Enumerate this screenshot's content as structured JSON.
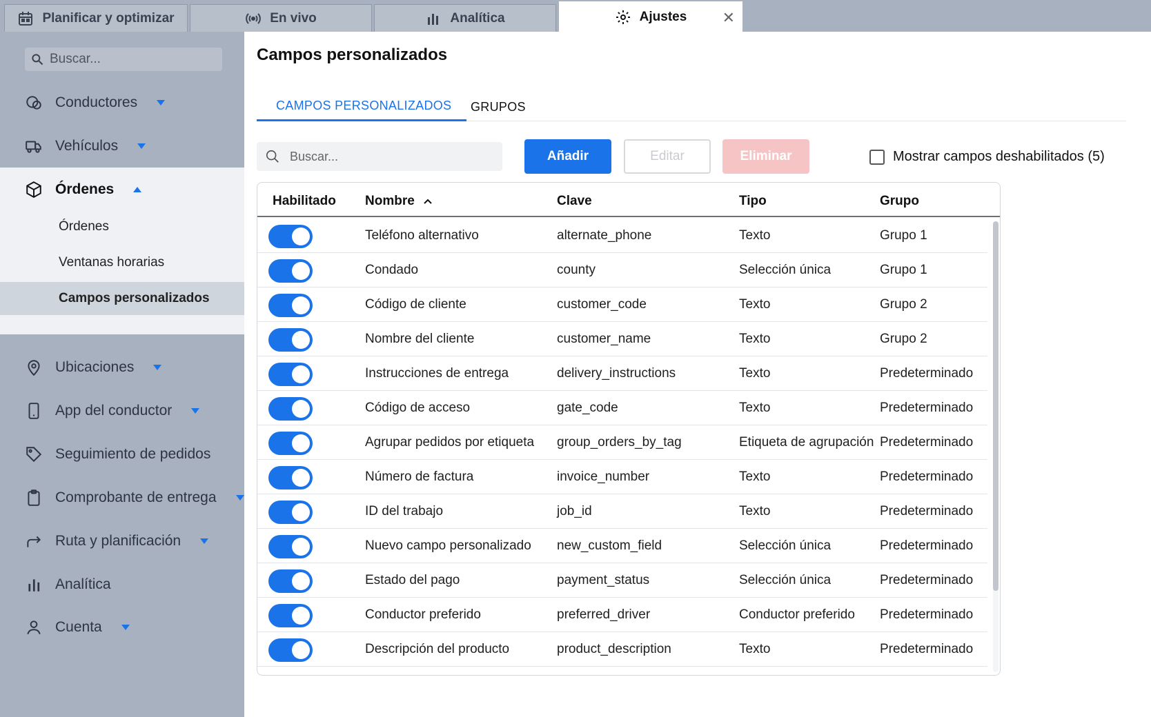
{
  "tabs": [
    {
      "label": "Planificar y optimizar",
      "icon": "calendar-icon"
    },
    {
      "label": "En vivo",
      "icon": "broadcast-icon"
    },
    {
      "label": "Analítica",
      "icon": "bar-chart-icon"
    },
    {
      "label": "Ajustes",
      "icon": "gear-icon",
      "active": true
    }
  ],
  "sidebar": {
    "search_placeholder": "Buscar...",
    "items": [
      {
        "label": "Conductores",
        "icon": "steering-icon"
      },
      {
        "label": "Vehículos",
        "icon": "truck-icon"
      },
      {
        "label": "Órdenes",
        "icon": "box-icon",
        "expanded": true
      },
      {
        "label": "Ubicaciones",
        "icon": "location-pin-icon"
      },
      {
        "label": "App del conductor",
        "icon": "phone-icon"
      },
      {
        "label": "Seguimiento de pedidos",
        "icon": "tag-icon"
      },
      {
        "label": "Comprobante de entrega",
        "icon": "clipboard-icon"
      },
      {
        "label": "Ruta y planificación",
        "icon": "route-arrow-icon"
      },
      {
        "label": "Analítica",
        "icon": "bar-chart-icon"
      },
      {
        "label": "Cuenta",
        "icon": "user-icon"
      }
    ],
    "sub_items": [
      "Órdenes",
      "Ventanas horarias",
      "Campos personalizados"
    ]
  },
  "main": {
    "title": "Campos personalizados",
    "subtabs": [
      "CAMPOS PERSONALIZADOS",
      "GRUPOS"
    ],
    "search_placeholder": "Buscar...",
    "buttons": {
      "add": "Añadir",
      "edit": "Editar",
      "delete": "Eliminar"
    },
    "show_disabled_label": "Mostrar campos deshabilitados (5)",
    "table": {
      "headers": [
        "Habilitado",
        "Nombre",
        "Clave",
        "Tipo",
        "Grupo"
      ],
      "rows": [
        {
          "enabled": true,
          "name": "Teléfono alternativo",
          "key": "alternate_phone",
          "type": "Texto",
          "group": "Grupo 1"
        },
        {
          "enabled": true,
          "name": "Condado",
          "key": "county",
          "type": "Selección única",
          "group": "Grupo 1"
        },
        {
          "enabled": true,
          "name": "Código de cliente",
          "key": "customer_code",
          "type": "Texto",
          "group": "Grupo 2"
        },
        {
          "enabled": true,
          "name": "Nombre del cliente",
          "key": "customer_name",
          "type": "Texto",
          "group": "Grupo 2"
        },
        {
          "enabled": true,
          "name": "Instrucciones de entrega",
          "key": "delivery_instructions",
          "type": "Texto",
          "group": "Predeterminado"
        },
        {
          "enabled": true,
          "name": "Código de acceso",
          "key": "gate_code",
          "type": "Texto",
          "group": "Predeterminado"
        },
        {
          "enabled": true,
          "name": "Agrupar pedidos por etiqueta",
          "key": "group_orders_by_tag",
          "type": "Etiqueta de agrupación",
          "group": "Predeterminado"
        },
        {
          "enabled": true,
          "name": "Número de factura",
          "key": "invoice_number",
          "type": "Texto",
          "group": "Predeterminado"
        },
        {
          "enabled": true,
          "name": "ID del trabajo",
          "key": "job_id",
          "type": "Texto",
          "group": "Predeterminado"
        },
        {
          "enabled": true,
          "name": "Nuevo campo personalizado",
          "key": "new_custom_field",
          "type": "Selección única",
          "group": "Predeterminado"
        },
        {
          "enabled": true,
          "name": "Estado del pago",
          "key": "payment_status",
          "type": "Selección única",
          "group": "Predeterminado"
        },
        {
          "enabled": true,
          "name": "Conductor preferido",
          "key": "preferred_driver",
          "type": "Conductor preferido",
          "group": "Predeterminado"
        },
        {
          "enabled": true,
          "name": "Descripción del producto",
          "key": "product_description",
          "type": "Texto",
          "group": "Predeterminado"
        }
      ]
    }
  }
}
